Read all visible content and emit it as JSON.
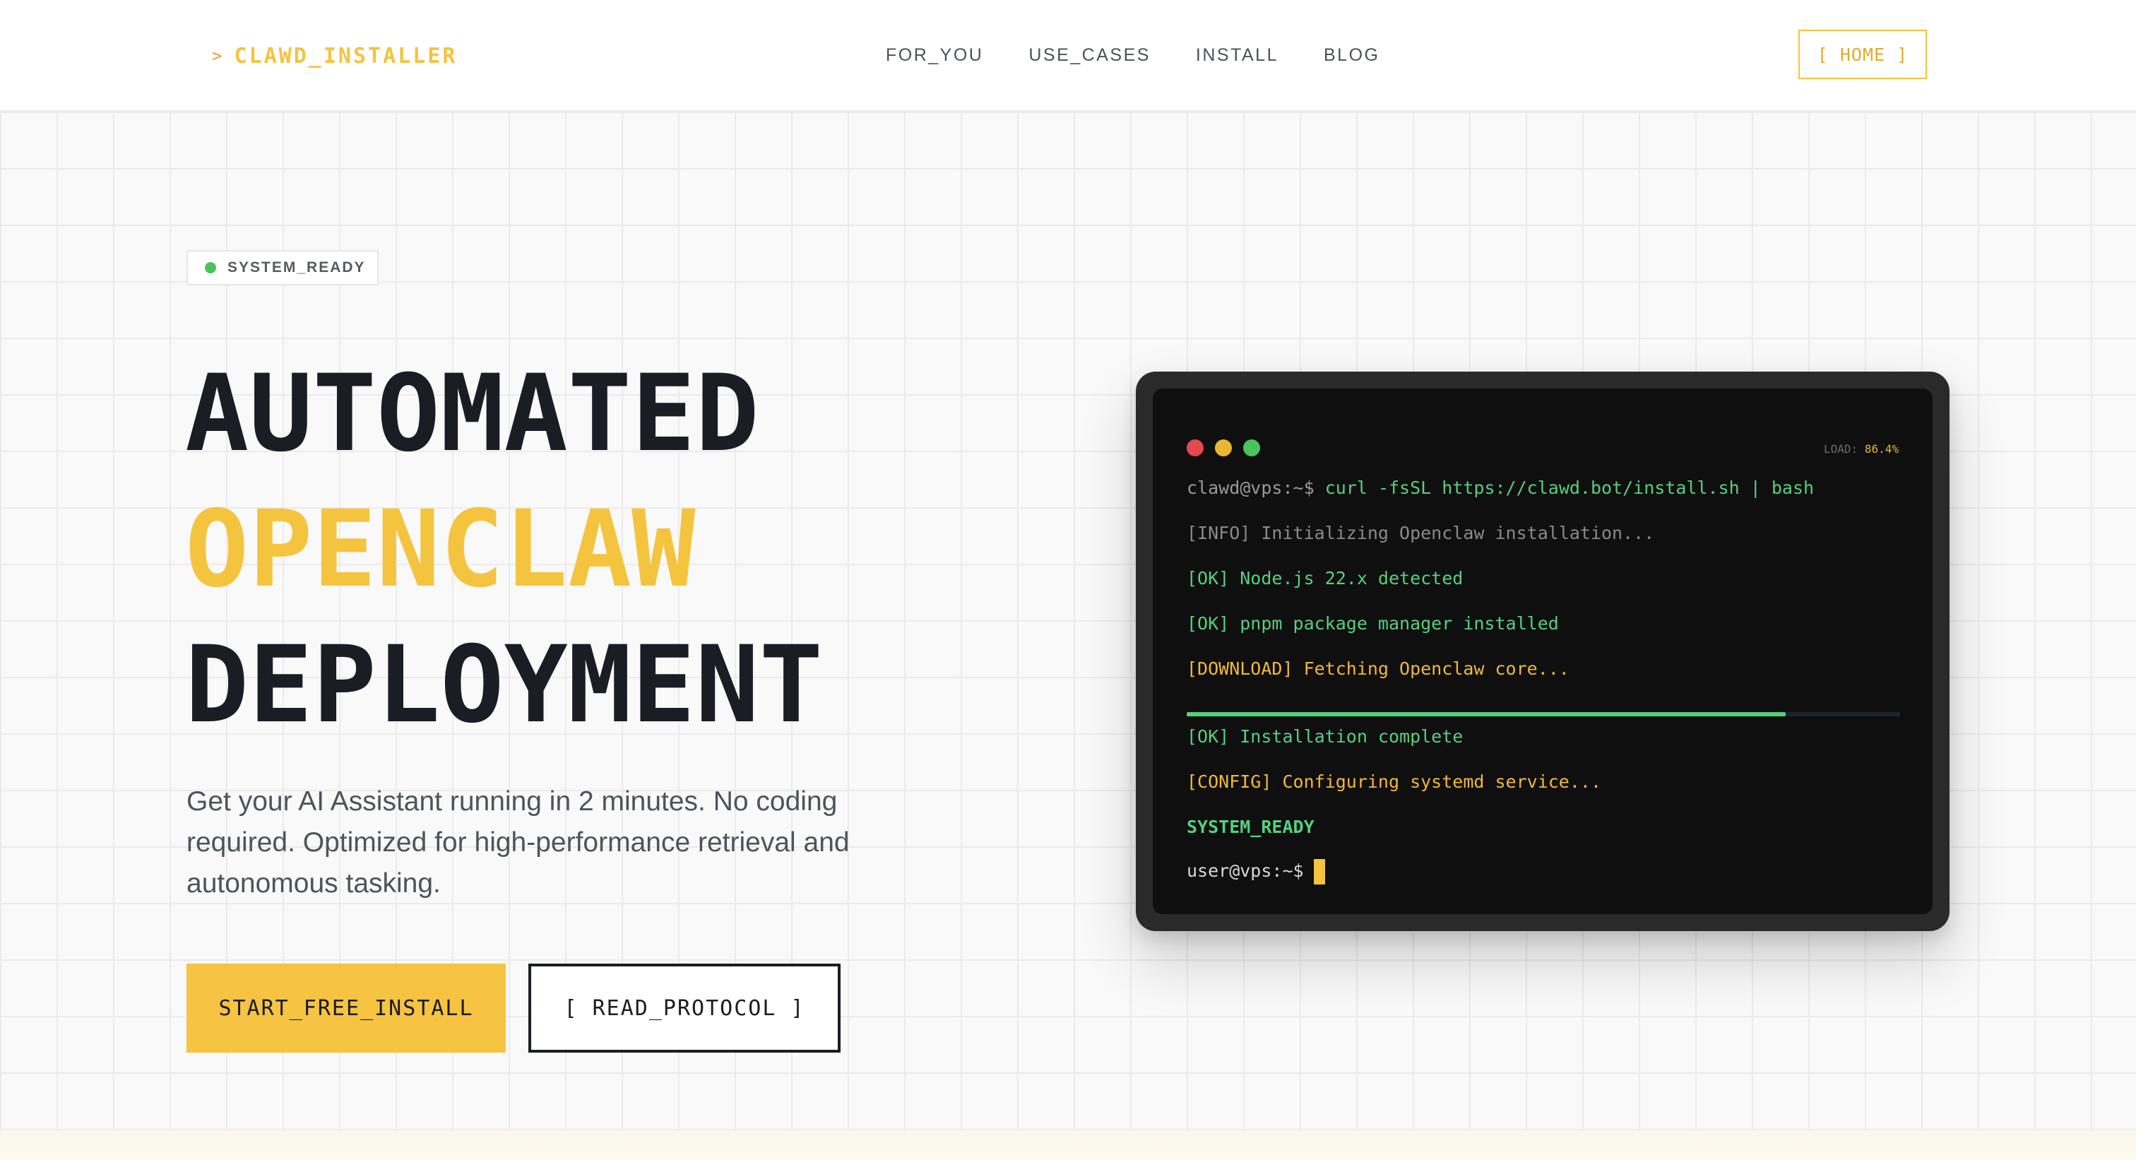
{
  "header": {
    "logo_chevron": ">",
    "logo_text": "CLAWD_INSTALLER",
    "nav": [
      "FOR_YOU",
      "USE_CASES",
      "INSTALL",
      "BLOG"
    ],
    "home_button": "[ HOME ]"
  },
  "hero": {
    "badge": "SYSTEM_READY",
    "headline_line1": "AUTOMATED",
    "headline_line2": "OPENCLAW",
    "headline_line3": "DEPLOYMENT",
    "subtitle": "Get your AI Assistant running in 2 minutes. No coding required. Optimized for high-performance retrieval and autonomous tasking.",
    "primary_button": "START_FREE_INSTALL",
    "secondary_button": "[ READ_PROTOCOL ]"
  },
  "terminal": {
    "load_label": "LOAD:",
    "load_value": "86.4%",
    "prompt1": "clawd@vps:~$",
    "command1": "curl -fsSL https://clawd.bot/install.sh | bash",
    "line_info": "[INFO] Initializing Openclaw installation...",
    "line_node": "[OK] Node.js 22.x detected",
    "line_pnpm": "[OK] pnpm package manager installed",
    "line_download": "[DOWNLOAD] Fetching Openclaw core...",
    "progress_fraction": 0.84,
    "line_complete": "[OK] Installation complete",
    "line_config": "[CONFIG] Configuring systemd service...",
    "line_ready": "SYSTEM_READY",
    "prompt2": "user@vps:~$"
  },
  "colors": {
    "accent": "#f4c43f",
    "dark": "#1a1d24",
    "terminal_green": "#57d07c",
    "terminal_yellow": "#f2b937",
    "status_green": "#4cc35a"
  },
  "icons": {
    "logo": "chevron-right-icon",
    "badge": "status-dot-icon",
    "cursor": "terminal-cursor-icon"
  }
}
